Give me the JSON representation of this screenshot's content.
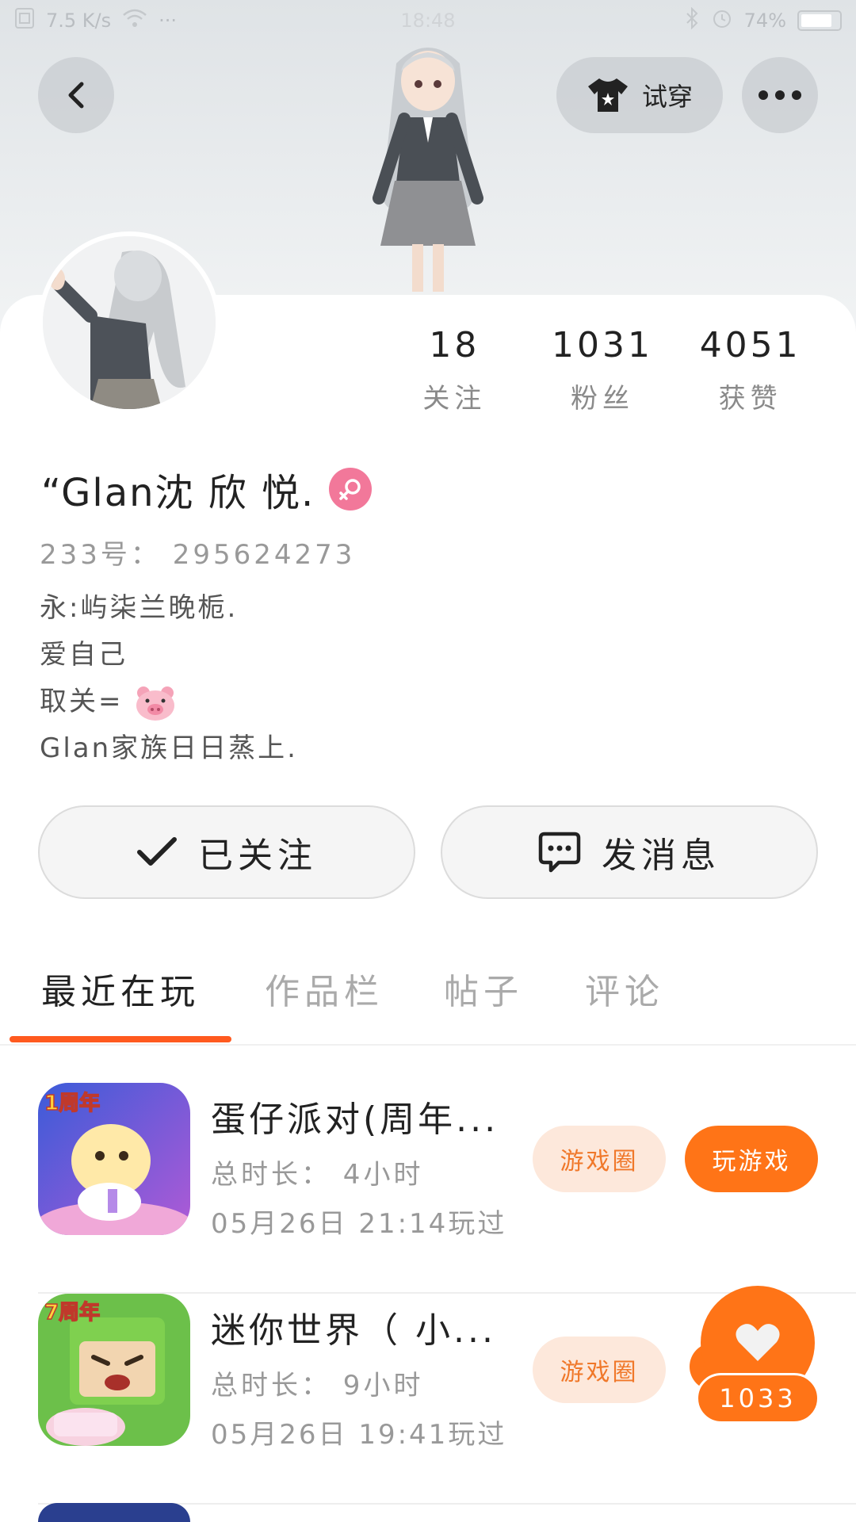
{
  "status_bar": {
    "network_speed": "7.5 K/s",
    "time": "18:48",
    "battery": "74%"
  },
  "header": {
    "tryon_label": "试穿"
  },
  "profile": {
    "stats": [
      {
        "value": "18",
        "label": "关注"
      },
      {
        "value": "1031",
        "label": "粉丝"
      },
      {
        "value": "4051",
        "label": "获赞"
      }
    ],
    "name": "“Glan沈 欣 悦.",
    "uid": "233号： 295624273",
    "bio": [
      "永:屿柒兰晚栀.",
      "爱自己",
      "取关=",
      "Glan家族日日蒸上."
    ],
    "follow_label": "已关注",
    "message_label": "发消息"
  },
  "tabs": [
    {
      "label": "最近在玩",
      "active": true
    },
    {
      "label": "作品栏",
      "active": false
    },
    {
      "label": "帖子",
      "active": false
    },
    {
      "label": "评论",
      "active": false
    }
  ],
  "games": [
    {
      "title": "蛋仔派对(周年...",
      "duration": "总时长： 4小时",
      "last_played": "05月26日 21:14玩过",
      "circle_label": "游戏圈",
      "play_label": "玩游戏",
      "icon_badge": "1周年"
    },
    {
      "title": "迷你世界（ 小...",
      "duration": "总时长： 9小时",
      "last_played": "05月26日 19:41玩过",
      "circle_label": "游戏圈",
      "icon_badge": "7周年"
    }
  ],
  "like_count": "1033",
  "colors": {
    "accent": "#ff7417",
    "tab_underline": "#ff5a1f",
    "gender_badge": "#f2789a"
  }
}
